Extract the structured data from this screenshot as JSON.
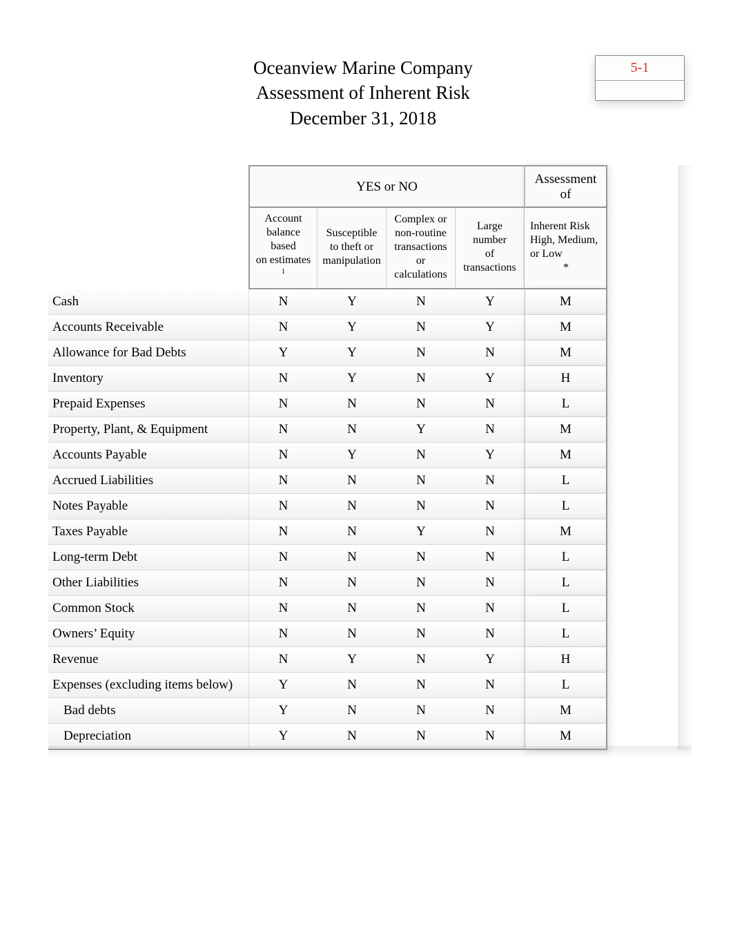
{
  "header": {
    "company": "Oceanview Marine Company",
    "report": "Assessment of Inherent Risk",
    "date": "December 31, 2018",
    "page_ref": "5-1"
  },
  "table": {
    "group_headers": {
      "yes_no": "YES or NO",
      "assessment": "Assessment of"
    },
    "column_headers": {
      "c1_line1": "Account",
      "c1_line2": "balance based",
      "c1_line3": "on estimates ",
      "c1_sup": "1",
      "c2_line1": "Susceptible",
      "c2_line2": "to theft or",
      "c2_line3": "manipulation",
      "c3_line1": "Complex or",
      "c3_line2": "non-routine",
      "c3_line3": "transactions or",
      "c3_line4": "calculations",
      "c4_line1": "Large number",
      "c4_line2": "of",
      "c4_line3": "transactions",
      "c5_line1": "Inherent Risk",
      "c5_line2": "High, Medium,",
      "c5_line3": "or Low",
      "c5_line4": "*"
    },
    "rows": [
      {
        "account": "Cash",
        "indent": false,
        "c1": "N",
        "c2": "Y",
        "c3": "N",
        "c4": "Y",
        "assess": "M"
      },
      {
        "account": "Accounts Receivable",
        "indent": false,
        "c1": "N",
        "c2": "Y",
        "c3": "N",
        "c4": "Y",
        "assess": "M"
      },
      {
        "account": "Allowance for Bad Debts",
        "indent": false,
        "c1": "Y",
        "c2": "Y",
        "c3": "N",
        "c4": "N",
        "assess": "M"
      },
      {
        "account": "Inventory",
        "indent": false,
        "c1": "N",
        "c2": "Y",
        "c3": "N",
        "c4": "Y",
        "assess": "H"
      },
      {
        "account": "Prepaid Expenses",
        "indent": false,
        "c1": "N",
        "c2": "N",
        "c3": "N",
        "c4": "N",
        "assess": "L"
      },
      {
        "account": "Property, Plant, & Equipment",
        "indent": false,
        "c1": "N",
        "c2": "N",
        "c3": "Y",
        "c4": "N",
        "assess": "M"
      },
      {
        "account": "Accounts Payable",
        "indent": false,
        "c1": "N",
        "c2": "Y",
        "c3": "N",
        "c4": "Y",
        "assess": "M"
      },
      {
        "account": "Accrued Liabilities",
        "indent": false,
        "c1": "N",
        "c2": "N",
        "c3": "N",
        "c4": "N",
        "assess": "L"
      },
      {
        "account": "Notes Payable",
        "indent": false,
        "c1": "N",
        "c2": "N",
        "c3": "N",
        "c4": "N",
        "assess": "L"
      },
      {
        "account": "Taxes Payable",
        "indent": false,
        "c1": "N",
        "c2": "N",
        "c3": "Y",
        "c4": "N",
        "assess": "M"
      },
      {
        "account": "Long-term Debt",
        "indent": false,
        "c1": "N",
        "c2": "N",
        "c3": "N",
        "c4": "N",
        "assess": "L"
      },
      {
        "account": "Other Liabilities",
        "indent": false,
        "c1": "N",
        "c2": "N",
        "c3": "N",
        "c4": "N",
        "assess": "L"
      },
      {
        "account": "Common Stock",
        "indent": false,
        "c1": "N",
        "c2": "N",
        "c3": "N",
        "c4": "N",
        "assess": "L"
      },
      {
        "account": "Owners’ Equity",
        "indent": false,
        "c1": "N",
        "c2": "N",
        "c3": "N",
        "c4": "N",
        "assess": "L"
      },
      {
        "account": "Revenue",
        "indent": false,
        "c1": "N",
        "c2": "Y",
        "c3": "N",
        "c4": "Y",
        "assess": "H"
      },
      {
        "account": "Expenses (excluding items below)",
        "indent": false,
        "c1": "Y",
        "c2": "N",
        "c3": "N",
        "c4": "N",
        "assess": "L"
      },
      {
        "account": "Bad debts",
        "indent": true,
        "c1": "Y",
        "c2": "N",
        "c3": "N",
        "c4": "N",
        "assess": "M"
      },
      {
        "account": "Depreciation",
        "indent": true,
        "c1": "Y",
        "c2": "N",
        "c3": "N",
        "c4": "N",
        "assess": "M"
      }
    ]
  }
}
